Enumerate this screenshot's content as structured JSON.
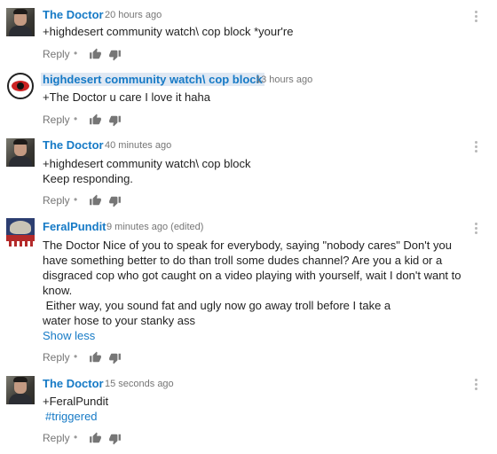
{
  "comments": [
    {
      "author": "The Doctor",
      "time": "20 hours ago",
      "lines": [
        "+highdesert community watch\\ cop block *your're"
      ],
      "reply_label": "Reply"
    },
    {
      "author": "highdesert community watch\\ cop block",
      "time": "13 hours ago",
      "lines": [
        "+The Doctor u care I love it haha"
      ],
      "reply_label": "Reply"
    },
    {
      "author": "The Doctor",
      "time": "40 minutes ago",
      "lines": [
        "+highdesert community watch\\ cop block",
        "Keep responding."
      ],
      "reply_label": "Reply"
    },
    {
      "author": "FeralPundit",
      "time": "9 minutes ago (edited)",
      "lines": [
        "The Doctor Nice of you to speak for everybody, saying \"nobody cares\" Don't you",
        "have something better to do than troll some dudes channel? Are you a kid or a",
        "disgraced cop who got caught on a video playing with yourself, wait I don't want to",
        "know.",
        " Either way, you sound fat and ugly now go away troll before I take a",
        "water hose to your stanky ass"
      ],
      "show_less": "Show less",
      "reply_label": "Reply"
    },
    {
      "author": "The Doctor",
      "time": "15 seconds ago",
      "lines": [
        "+FeralPundit"
      ],
      "hashtag": "#triggered",
      "reply_label": "Reply"
    }
  ],
  "colors": {
    "link": "#167ac6",
    "meta": "#767676",
    "text": "#222222"
  },
  "icons": {
    "like": "thumbs-up-icon",
    "dislike": "thumbs-down-icon",
    "menu": "more-vertical-icon"
  }
}
